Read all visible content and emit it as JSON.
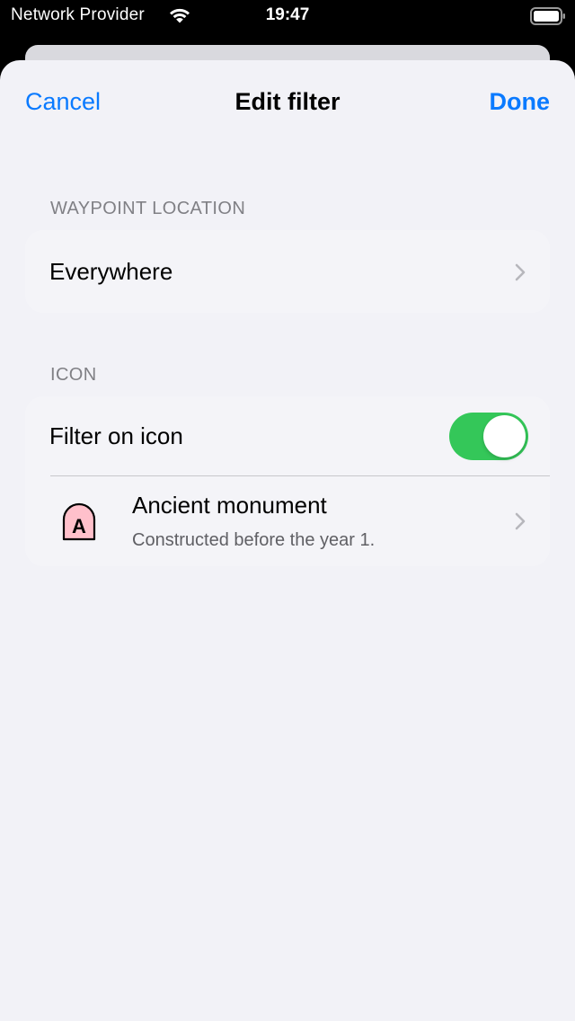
{
  "status_bar": {
    "carrier": "Network Provider",
    "time": "19:47",
    "wifi_icon": "wifi-icon",
    "battery_icon": "battery-icon"
  },
  "nav": {
    "cancel_label": "Cancel",
    "title": "Edit filter",
    "done_label": "Done"
  },
  "waypoint_location": {
    "header": "WAYPOINT LOCATION",
    "value": "Everywhere"
  },
  "icon_section": {
    "header": "ICON",
    "filter_label": "Filter on icon",
    "filter_enabled": true,
    "selected_icon": {
      "letter": "A",
      "title": "Ancient monument",
      "subtitle": "Constructed before the year 1."
    }
  },
  "colors": {
    "accent": "#0a7aff",
    "toggle_on": "#34c759",
    "icon_fill": "#ffc0cb",
    "background": "#f2f2f7"
  }
}
